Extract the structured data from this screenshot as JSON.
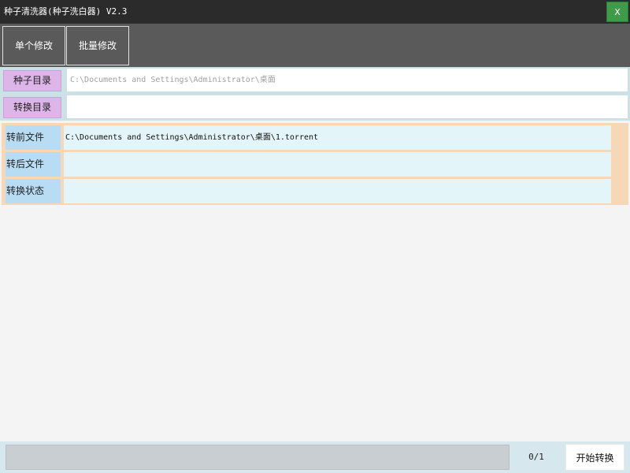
{
  "window": {
    "title": "种子清洗器(种子洗白器) V2.3",
    "close_label": "X"
  },
  "tabs": [
    {
      "label": "单个修改"
    },
    {
      "label": "批量修改"
    }
  ],
  "directories": {
    "seed_dir": {
      "label": "种子目录",
      "value": "",
      "placeholder": "C:\\Documents and Settings\\Administrator\\桌面"
    },
    "convert_dir": {
      "label": "转换目录",
      "value": "",
      "placeholder": ""
    }
  },
  "info": {
    "before_file": {
      "label": "转前文件",
      "value": "C:\\Documents and Settings\\Administrator\\桌面\\1.torrent"
    },
    "after_file": {
      "label": "转后文件",
      "value": ""
    },
    "status": {
      "label": "转换状态",
      "value": ""
    }
  },
  "footer": {
    "progress": 0,
    "count_text": "0/1",
    "start_label": "开始转换"
  },
  "colors": {
    "titlebar": "#2b2b2b",
    "close_button": "#3f9a4a",
    "tabbar": "#5a5a5a",
    "dir_label": "#ddb5e8",
    "info_label": "#b7dcf3",
    "info_value": "#e4f5fa",
    "info_panel": "#f6d8b8"
  }
}
